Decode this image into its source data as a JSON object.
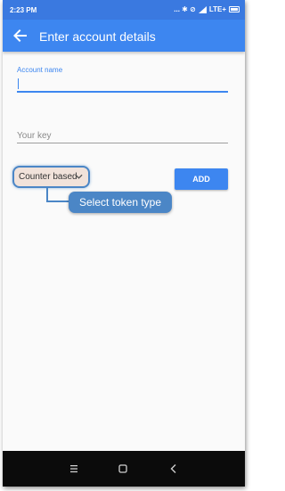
{
  "status_bar": {
    "time": "2:23 PM",
    "indicators": "... ✱ ⊘",
    "network": "LTE+"
  },
  "app_bar": {
    "title": "Enter account details",
    "back_icon": "arrow-back-icon"
  },
  "form": {
    "account_name": {
      "label": "Account name",
      "value": ""
    },
    "key": {
      "placeholder": "Your key",
      "value": ""
    },
    "token_type": {
      "selected": "Counter based"
    },
    "add_label": "ADD"
  },
  "callout": {
    "text": "Select token type"
  },
  "colors": {
    "primary": "#3d86f0",
    "status_bar": "#3a79e0",
    "callout": "#4b86c6",
    "nav_bar": "#0b0b0b"
  }
}
